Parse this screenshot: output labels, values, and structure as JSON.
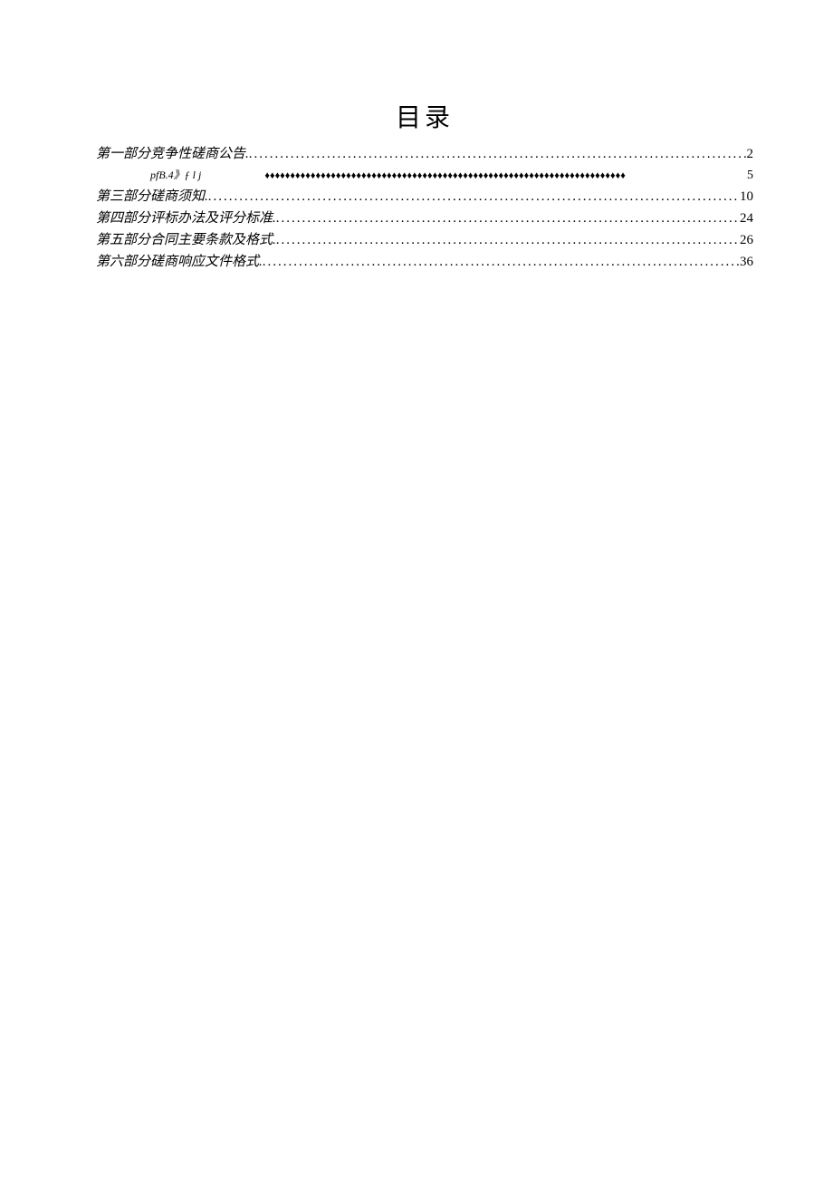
{
  "title": "目录",
  "toc": {
    "entry1": {
      "label": "第一部分竞争性磋商公告.",
      "page": "2"
    },
    "entry2": {
      "label": "pfB.4》ƒ l j",
      "page": "5"
    },
    "entry3": {
      "label": "第三部分磋商须知.",
      "page": "10"
    },
    "entry4": {
      "label": "第四部分评标办法及评分标准.",
      "page": "24"
    },
    "entry5": {
      "label": "第五部分合同主要条款及格式.",
      "page": "26"
    },
    "entry6": {
      "label": "第六部分磋商响应文件格式.",
      "page": "36"
    }
  },
  "dots": "..........................................................................................................................................................................................",
  "diamonds": "♦♦♦♦♦♦♦♦♦♦♦♦♦♦♦♦♦♦♦♦♦♦♦♦♦♦♦♦♦♦♦♦♦♦♦♦♦♦♦♦♦♦♦♦♦♦♦♦♦♦♦♦♦♦♦♦♦♦♦♦♦♦♦♦♦♦♦♦♦♦♦"
}
